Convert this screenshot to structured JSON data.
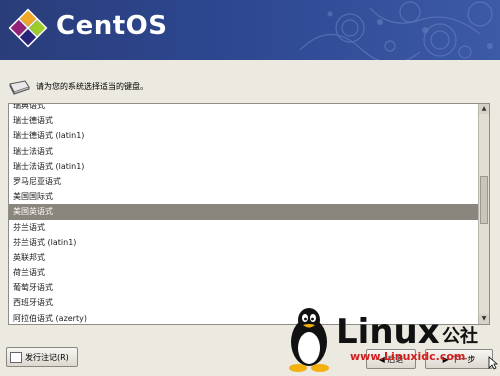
{
  "banner": {
    "brand": "CentOS"
  },
  "prompt": {
    "text": "请为您的系统选择适当的键盘。"
  },
  "keyboard_list": {
    "items": [
      "瑞典语式",
      "瑞士德语式",
      "瑞士德语式 (latin1)",
      "瑞士法语式",
      "瑞士法语式 (latin1)",
      "罗马尼亚语式",
      "美国国际式",
      "美国英语式",
      "芬兰语式",
      "芬兰语式 (latin1)",
      "英联邦式",
      "荷兰语式",
      "葡萄牙语式",
      "西班牙语式",
      "阿拉伯语式 (azerty)"
    ],
    "selected_index": 7
  },
  "buttons": {
    "release_notes": "发行注记(R)",
    "back": "◀ 后退",
    "next": "▶ 下一步"
  },
  "watermark": {
    "brand": "Linux",
    "suffix": "公社",
    "url": "www.Linuxidc.com"
  }
}
